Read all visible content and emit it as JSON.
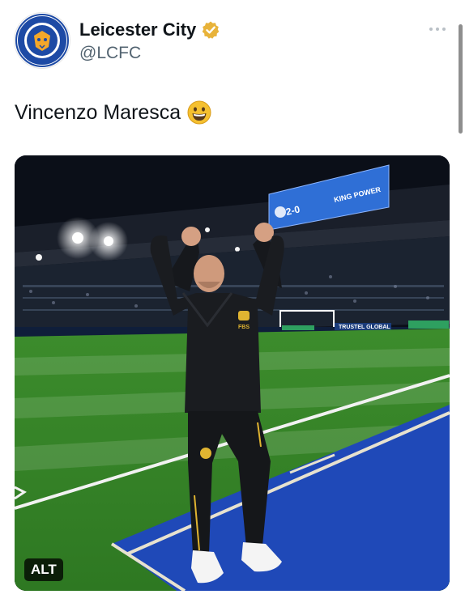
{
  "tweet": {
    "author": {
      "display_name": "Leicester City",
      "handle": "@LCFC",
      "verified": true,
      "avatar_text": "LEICESTER CITY FOOTBALL CLUB"
    },
    "more_icon": "ellipsis-icon",
    "text": "Vincenzo Maresca",
    "emoji": "grinning-face-emoji",
    "media": {
      "alt_label": "ALT",
      "scoreboard_score": "2-0",
      "scoreboard_sponsor": "KING POWER",
      "ad_board_text": "TRUSTEL GLOBAL",
      "kit_text": "FBS"
    }
  },
  "colors": {
    "verified_gold": "#e8b33a",
    "club_blue": "#1d4aa5",
    "pitch_green": "#3a8b2a",
    "scoreboard_blue": "#2f6fd6"
  }
}
